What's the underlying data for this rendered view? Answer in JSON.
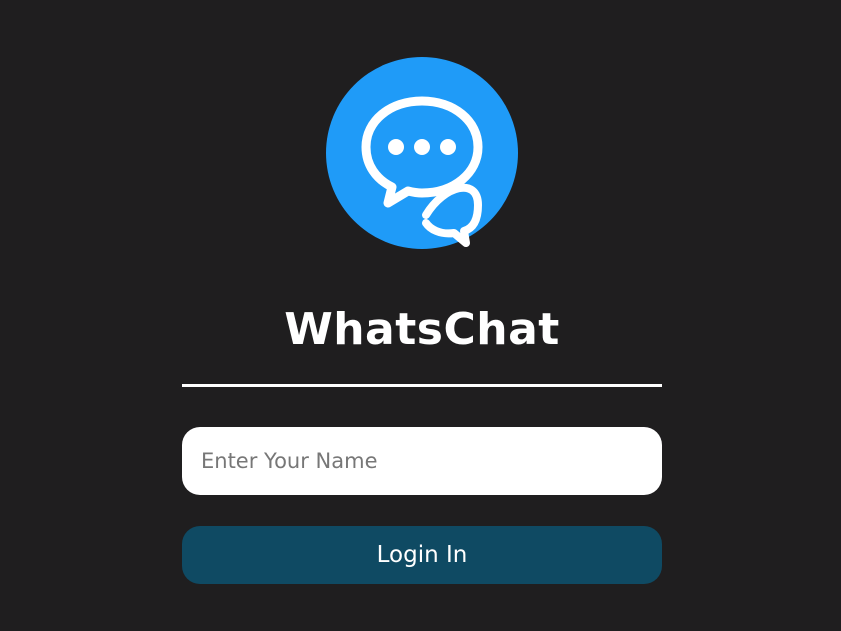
{
  "app": {
    "title": "WhatsChat",
    "logo_icon": "chat-bubbles-icon"
  },
  "form": {
    "name_placeholder": "Enter Your Name",
    "name_value": "",
    "login_label": "Login In"
  },
  "colors": {
    "background": "#1f1e1f",
    "logo_circle": "#1f9bf8",
    "button": "#0f4a63",
    "text": "#ffffff"
  }
}
